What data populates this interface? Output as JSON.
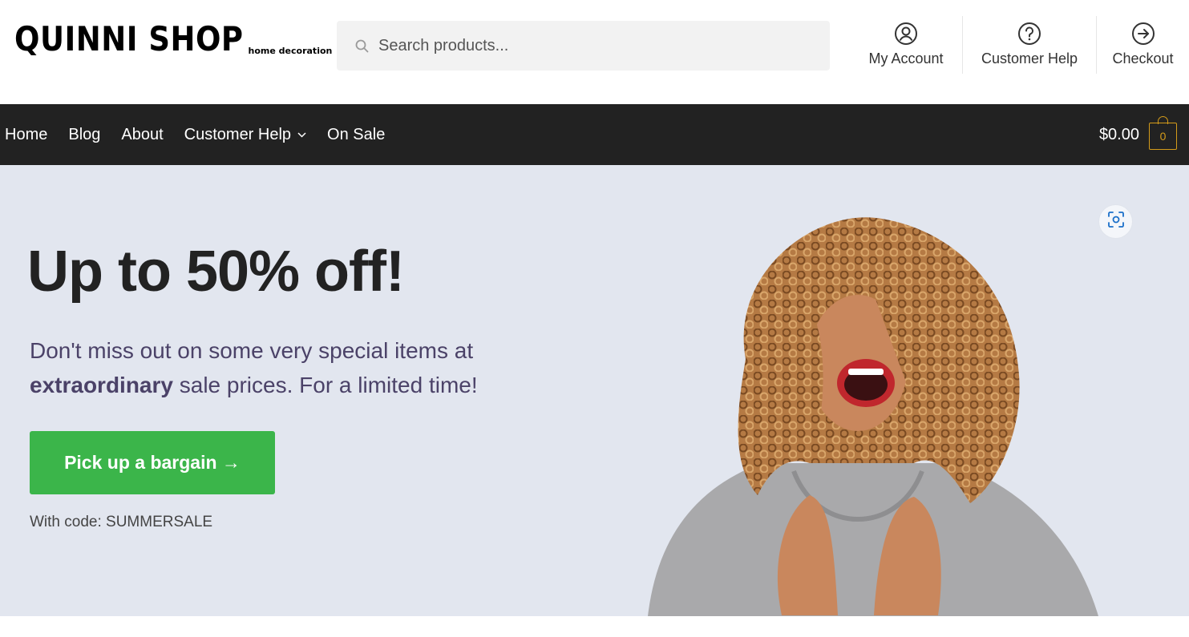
{
  "header": {
    "logo": {
      "main": "QUINNI SHOP",
      "sub": "home decoration"
    },
    "search": {
      "placeholder": "Search products...",
      "value": ""
    },
    "links": [
      {
        "label": "My Account",
        "icon": "user-circle-icon"
      },
      {
        "label": "Customer Help",
        "icon": "question-circle-icon"
      },
      {
        "label": "Checkout",
        "icon": "arrow-right-circle-icon"
      }
    ]
  },
  "nav": {
    "items": [
      {
        "label": "Home"
      },
      {
        "label": "Blog"
      },
      {
        "label": "About"
      },
      {
        "label": "Customer Help",
        "has_dropdown": true
      },
      {
        "label": "On Sale"
      }
    ],
    "cart": {
      "total": "$0.00",
      "count": "0"
    }
  },
  "hero": {
    "title": "Up to 50% off!",
    "desc_part1": "Don't miss out on some very special items at ",
    "desc_bold": "extraordinary",
    "desc_part2": " sale prices. For a limited time!",
    "cta_label": "Pick up a bargain →",
    "code_note": "With code: SUMMERSALE"
  },
  "colors": {
    "nav_bg": "#222222",
    "hero_bg": "#e2e6ef",
    "cta_green": "#3bb54a",
    "cart_accent": "#d49b1a",
    "desc_text": "#4b4268"
  }
}
